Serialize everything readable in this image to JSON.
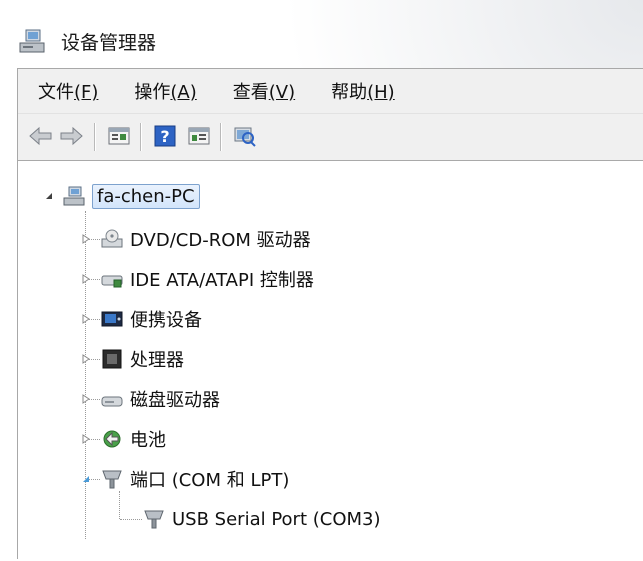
{
  "window": {
    "title": "设备管理器"
  },
  "menu": [
    {
      "label": "文件",
      "key": "(F)"
    },
    {
      "label": "操作",
      "key": "(A)"
    },
    {
      "label": "查看",
      "key": "(V)"
    },
    {
      "label": "帮助",
      "key": "(H)"
    }
  ],
  "toolbar_icons": [
    "back-arrow-icon",
    "forward-arrow-icon",
    "properties-icon",
    "help-icon",
    "details-icon",
    "scan-hardware-icon"
  ],
  "tree": {
    "root": "fa-chen-PC",
    "items": [
      {
        "label": "DVD/CD-ROM 驱动器",
        "icon": "dvd-drive-icon",
        "state": "collapsed"
      },
      {
        "label": "IDE ATA/ATAPI 控制器",
        "icon": "ide-controller-icon",
        "state": "collapsed"
      },
      {
        "label": "便携设备",
        "icon": "portable-device-icon",
        "state": "collapsed"
      },
      {
        "label": "处理器",
        "icon": "processor-icon",
        "state": "collapsed"
      },
      {
        "label": "磁盘驱动器",
        "icon": "disk-drive-icon",
        "state": "collapsed"
      },
      {
        "label": "电池",
        "icon": "battery-icon",
        "state": "collapsed"
      },
      {
        "label": "端口 (COM 和 LPT)",
        "icon": "port-icon",
        "state": "expanded"
      }
    ],
    "child": {
      "label": "USB Serial Port (COM3)",
      "icon": "port-icon"
    }
  },
  "colors": {
    "selection_border": "#7da2ce",
    "menubar_bg": "#f0f0f0"
  }
}
